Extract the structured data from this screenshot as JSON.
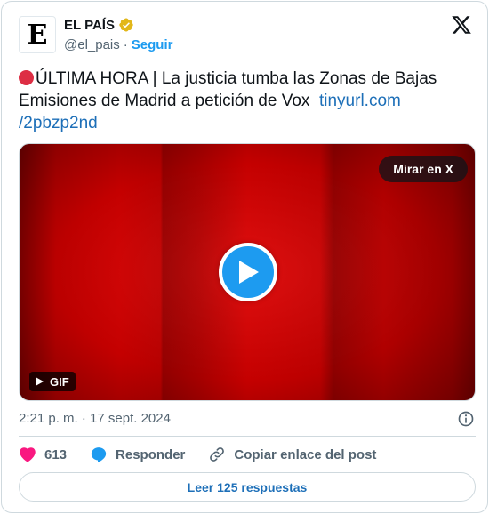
{
  "author": {
    "avatar_letter": "E",
    "display_name": "EL PAÍS",
    "handle": "@el_pais",
    "separator": "·",
    "follow_label": "Seguir"
  },
  "tweet": {
    "text": "ÚLTIMA HORA | La justicia tumba las Zonas de Bajas Emisiones de Madrid a petición de Vox",
    "link_line1": "tinyurl.com",
    "link_line2": "/2pbzp2nd"
  },
  "media": {
    "watch_label": "Mirar en X",
    "gif_label": "GIF"
  },
  "timestamp": "2:21 p. m. · 17 sept. 2024",
  "actions": {
    "like_count": "613",
    "reply_label": "Responder",
    "copy_label": "Copiar enlace del post"
  },
  "read_replies_label": "Leer 125 respuestas",
  "colors": {
    "accent": "#1d9bf0",
    "like": "#f91880",
    "verified": "#e2b719",
    "breaking_circle": "#dd2e44"
  }
}
